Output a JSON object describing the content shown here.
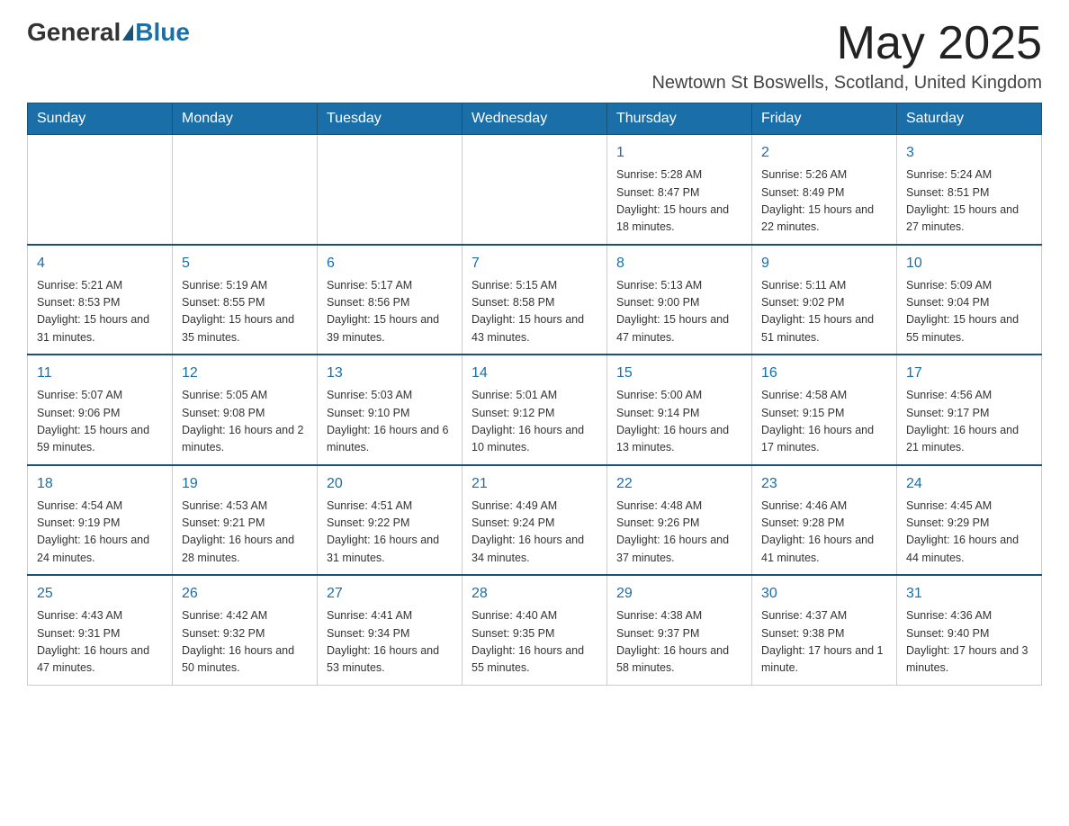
{
  "header": {
    "logo_general": "General",
    "logo_blue": "Blue",
    "month_year": "May 2025",
    "location": "Newtown St Boswells, Scotland, United Kingdom"
  },
  "days_of_week": [
    "Sunday",
    "Monday",
    "Tuesday",
    "Wednesday",
    "Thursday",
    "Friday",
    "Saturday"
  ],
  "weeks": [
    [
      {
        "day": "",
        "sunrise": "",
        "sunset": "",
        "daylight": ""
      },
      {
        "day": "",
        "sunrise": "",
        "sunset": "",
        "daylight": ""
      },
      {
        "day": "",
        "sunrise": "",
        "sunset": "",
        "daylight": ""
      },
      {
        "day": "",
        "sunrise": "",
        "sunset": "",
        "daylight": ""
      },
      {
        "day": "1",
        "sunrise": "Sunrise: 5:28 AM",
        "sunset": "Sunset: 8:47 PM",
        "daylight": "Daylight: 15 hours and 18 minutes."
      },
      {
        "day": "2",
        "sunrise": "Sunrise: 5:26 AM",
        "sunset": "Sunset: 8:49 PM",
        "daylight": "Daylight: 15 hours and 22 minutes."
      },
      {
        "day": "3",
        "sunrise": "Sunrise: 5:24 AM",
        "sunset": "Sunset: 8:51 PM",
        "daylight": "Daylight: 15 hours and 27 minutes."
      }
    ],
    [
      {
        "day": "4",
        "sunrise": "Sunrise: 5:21 AM",
        "sunset": "Sunset: 8:53 PM",
        "daylight": "Daylight: 15 hours and 31 minutes."
      },
      {
        "day": "5",
        "sunrise": "Sunrise: 5:19 AM",
        "sunset": "Sunset: 8:55 PM",
        "daylight": "Daylight: 15 hours and 35 minutes."
      },
      {
        "day": "6",
        "sunrise": "Sunrise: 5:17 AM",
        "sunset": "Sunset: 8:56 PM",
        "daylight": "Daylight: 15 hours and 39 minutes."
      },
      {
        "day": "7",
        "sunrise": "Sunrise: 5:15 AM",
        "sunset": "Sunset: 8:58 PM",
        "daylight": "Daylight: 15 hours and 43 minutes."
      },
      {
        "day": "8",
        "sunrise": "Sunrise: 5:13 AM",
        "sunset": "Sunset: 9:00 PM",
        "daylight": "Daylight: 15 hours and 47 minutes."
      },
      {
        "day": "9",
        "sunrise": "Sunrise: 5:11 AM",
        "sunset": "Sunset: 9:02 PM",
        "daylight": "Daylight: 15 hours and 51 minutes."
      },
      {
        "day": "10",
        "sunrise": "Sunrise: 5:09 AM",
        "sunset": "Sunset: 9:04 PM",
        "daylight": "Daylight: 15 hours and 55 minutes."
      }
    ],
    [
      {
        "day": "11",
        "sunrise": "Sunrise: 5:07 AM",
        "sunset": "Sunset: 9:06 PM",
        "daylight": "Daylight: 15 hours and 59 minutes."
      },
      {
        "day": "12",
        "sunrise": "Sunrise: 5:05 AM",
        "sunset": "Sunset: 9:08 PM",
        "daylight": "Daylight: 16 hours and 2 minutes."
      },
      {
        "day": "13",
        "sunrise": "Sunrise: 5:03 AM",
        "sunset": "Sunset: 9:10 PM",
        "daylight": "Daylight: 16 hours and 6 minutes."
      },
      {
        "day": "14",
        "sunrise": "Sunrise: 5:01 AM",
        "sunset": "Sunset: 9:12 PM",
        "daylight": "Daylight: 16 hours and 10 minutes."
      },
      {
        "day": "15",
        "sunrise": "Sunrise: 5:00 AM",
        "sunset": "Sunset: 9:14 PM",
        "daylight": "Daylight: 16 hours and 13 minutes."
      },
      {
        "day": "16",
        "sunrise": "Sunrise: 4:58 AM",
        "sunset": "Sunset: 9:15 PM",
        "daylight": "Daylight: 16 hours and 17 minutes."
      },
      {
        "day": "17",
        "sunrise": "Sunrise: 4:56 AM",
        "sunset": "Sunset: 9:17 PM",
        "daylight": "Daylight: 16 hours and 21 minutes."
      }
    ],
    [
      {
        "day": "18",
        "sunrise": "Sunrise: 4:54 AM",
        "sunset": "Sunset: 9:19 PM",
        "daylight": "Daylight: 16 hours and 24 minutes."
      },
      {
        "day": "19",
        "sunrise": "Sunrise: 4:53 AM",
        "sunset": "Sunset: 9:21 PM",
        "daylight": "Daylight: 16 hours and 28 minutes."
      },
      {
        "day": "20",
        "sunrise": "Sunrise: 4:51 AM",
        "sunset": "Sunset: 9:22 PM",
        "daylight": "Daylight: 16 hours and 31 minutes."
      },
      {
        "day": "21",
        "sunrise": "Sunrise: 4:49 AM",
        "sunset": "Sunset: 9:24 PM",
        "daylight": "Daylight: 16 hours and 34 minutes."
      },
      {
        "day": "22",
        "sunrise": "Sunrise: 4:48 AM",
        "sunset": "Sunset: 9:26 PM",
        "daylight": "Daylight: 16 hours and 37 minutes."
      },
      {
        "day": "23",
        "sunrise": "Sunrise: 4:46 AM",
        "sunset": "Sunset: 9:28 PM",
        "daylight": "Daylight: 16 hours and 41 minutes."
      },
      {
        "day": "24",
        "sunrise": "Sunrise: 4:45 AM",
        "sunset": "Sunset: 9:29 PM",
        "daylight": "Daylight: 16 hours and 44 minutes."
      }
    ],
    [
      {
        "day": "25",
        "sunrise": "Sunrise: 4:43 AM",
        "sunset": "Sunset: 9:31 PM",
        "daylight": "Daylight: 16 hours and 47 minutes."
      },
      {
        "day": "26",
        "sunrise": "Sunrise: 4:42 AM",
        "sunset": "Sunset: 9:32 PM",
        "daylight": "Daylight: 16 hours and 50 minutes."
      },
      {
        "day": "27",
        "sunrise": "Sunrise: 4:41 AM",
        "sunset": "Sunset: 9:34 PM",
        "daylight": "Daylight: 16 hours and 53 minutes."
      },
      {
        "day": "28",
        "sunrise": "Sunrise: 4:40 AM",
        "sunset": "Sunset: 9:35 PM",
        "daylight": "Daylight: 16 hours and 55 minutes."
      },
      {
        "day": "29",
        "sunrise": "Sunrise: 4:38 AM",
        "sunset": "Sunset: 9:37 PM",
        "daylight": "Daylight: 16 hours and 58 minutes."
      },
      {
        "day": "30",
        "sunrise": "Sunrise: 4:37 AM",
        "sunset": "Sunset: 9:38 PM",
        "daylight": "Daylight: 17 hours and 1 minute."
      },
      {
        "day": "31",
        "sunrise": "Sunrise: 4:36 AM",
        "sunset": "Sunset: 9:40 PM",
        "daylight": "Daylight: 17 hours and 3 minutes."
      }
    ]
  ]
}
